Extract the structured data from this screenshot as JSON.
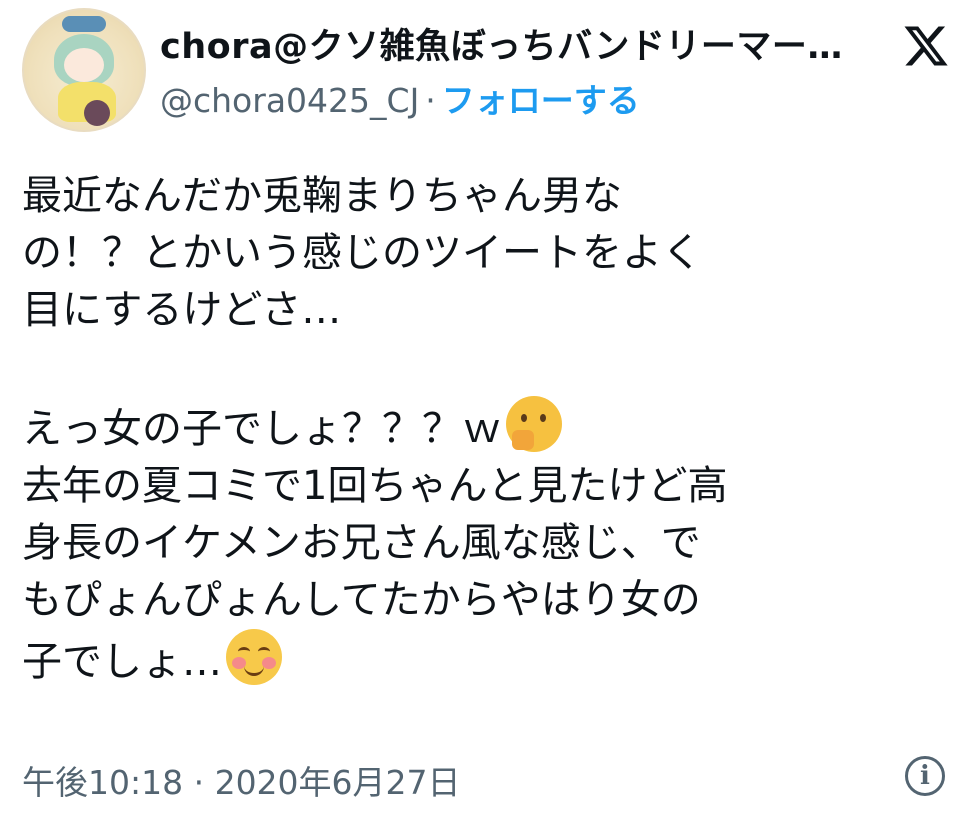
{
  "author": {
    "display_name": "chora@クソ雑魚ぼっちバンドリーマー…",
    "handle": "@chora0425_CJ",
    "separator": "·",
    "follow_label": "フォローする",
    "avatar_icon": "user-avatar-anime-character"
  },
  "platform": {
    "logo_icon": "x-logo-icon"
  },
  "tweet": {
    "lines": [
      "最近なんだか兎鞠まりちゃん男な",
      "の！？とかいう感じのツイートをよく",
      "目にするけどさ…",
      "",
      "えっ女の子でしょ？？？ｗ",
      "去年の夏コミで1回ちゃんと見たけど高",
      "身長のイケメンお兄さん風な感じ、で",
      "もぴょんぴょんしてたからやはり女の",
      "子でしょ…"
    ],
    "emoji_line5": "thinking-face-emoji",
    "emoji_line9": "smiling-face-emoji"
  },
  "meta": {
    "timestamp": "午後10:18 · 2020年6月27日",
    "info_icon": "info-icon",
    "info_glyph": "i"
  },
  "colors": {
    "accent": "#1d9bf0",
    "muted": "#536471",
    "text": "#0f1419"
  }
}
